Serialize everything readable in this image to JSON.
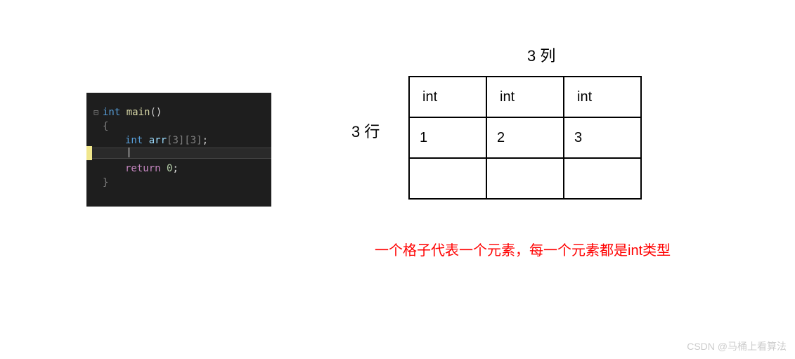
{
  "code": {
    "collapse_glyph": "⊟",
    "line1": {
      "type": "int",
      "func": "main",
      "parens": "()"
    },
    "line2": "{",
    "line3": {
      "type": "int",
      "var": "arr",
      "dim": "[3][3]",
      "semi": ";"
    },
    "line4": "",
    "line5": {
      "ret": "return",
      "val": "0",
      "semi": ";"
    },
    "line6": "}"
  },
  "diagram": {
    "col_label": "3 列",
    "row_label": "3 行",
    "cells": {
      "r0c0": "int",
      "r0c1": "int",
      "r0c2": "int",
      "r1c0": "1",
      "r1c1": "2",
      "r1c2": "3",
      "r2c0": "",
      "r2c1": "",
      "r2c2": ""
    },
    "caption": "一个格子代表一个元素，每一个元素都是int类型"
  },
  "watermark": "CSDN @马桶上看算法"
}
